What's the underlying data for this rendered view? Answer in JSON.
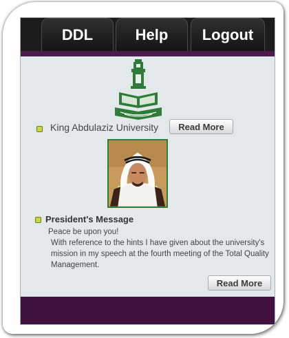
{
  "nav": {
    "tabs": [
      {
        "label": "DDL"
      },
      {
        "label": "Help"
      },
      {
        "label": "Logout"
      }
    ]
  },
  "university": {
    "name": "King Abdulaziz University",
    "read_more_label": "Read More",
    "logo_icon": "university-emblem-icon"
  },
  "president": {
    "title": "President's Message",
    "greeting": "Peace be upon you!",
    "body": "With reference to the hints I have given about the university's mission in my speech at the fourth meeting of the Total Quality Management.",
    "read_more_label": "Read More",
    "photo_icon": "president-portrait"
  },
  "colors": {
    "nav_background": "#1c1c1c",
    "accent_purple": "#4d1a4f",
    "panel_background": "#e3e8eb",
    "bullet_green": "#c9d842",
    "emblem_green": "#2f7c3a"
  }
}
